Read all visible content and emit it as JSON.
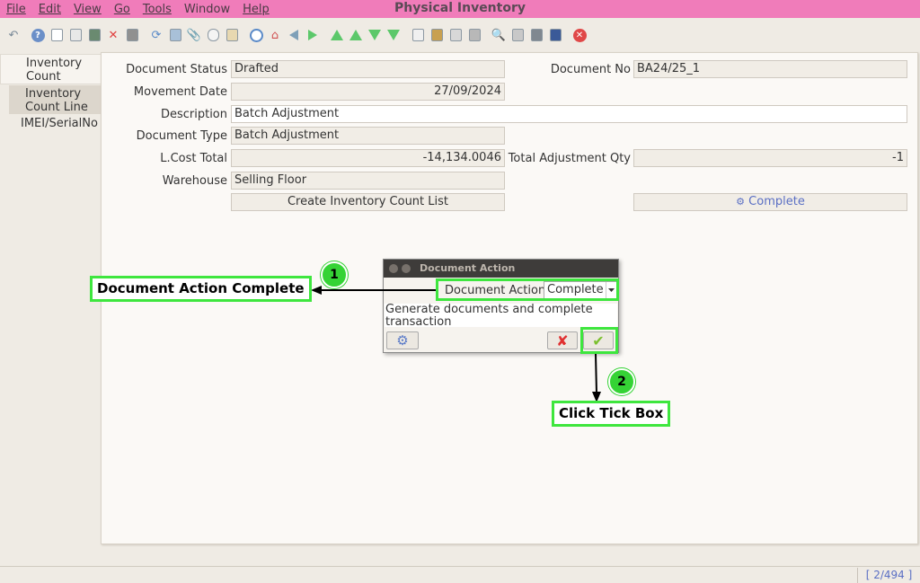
{
  "app": {
    "title": "Physical Inventory"
  },
  "menu": [
    "File",
    "Edit",
    "View",
    "Go",
    "Tools",
    "Window",
    "Help"
  ],
  "tabs": {
    "inventory_count": "Inventory Count",
    "count_line": "Inventory Count Line",
    "imei": "IMEI/SerialNo"
  },
  "form": {
    "document_status": {
      "label": "Document Status",
      "value": "Drafted"
    },
    "document_no": {
      "label": "Document No",
      "value": "BA24/25_1"
    },
    "movement_date": {
      "label": "Movement Date",
      "value": "27/09/2024"
    },
    "description": {
      "label": "Description",
      "value": "Batch Adjustment"
    },
    "document_type": {
      "label": "Document Type",
      "value": "Batch Adjustment"
    },
    "lcost_total": {
      "label": "L.Cost Total",
      "value": "-14,134.0046"
    },
    "total_adjustment_qty": {
      "label": "Total Adjustment Qty",
      "value": "-1"
    },
    "warehouse": {
      "label": "Warehouse",
      "value": "Selling Floor"
    },
    "create_list_button": "Create Inventory Count List",
    "complete_button": "Complete"
  },
  "dialog": {
    "title": "Document Action",
    "field_label": "Document Action",
    "selected": "Complete",
    "description": "Generate documents and complete transaction"
  },
  "annotations": {
    "step1_number": "1",
    "step1_text": "Document Action Complete",
    "step2_number": "2",
    "step2_text": "Click Tick Box",
    "highlight_color": "#3ee63e"
  },
  "status": {
    "record_count": "[ 2/494 ]"
  },
  "colors": {
    "menubar": "#f07cba",
    "accent_link": "#5a6fc4"
  }
}
